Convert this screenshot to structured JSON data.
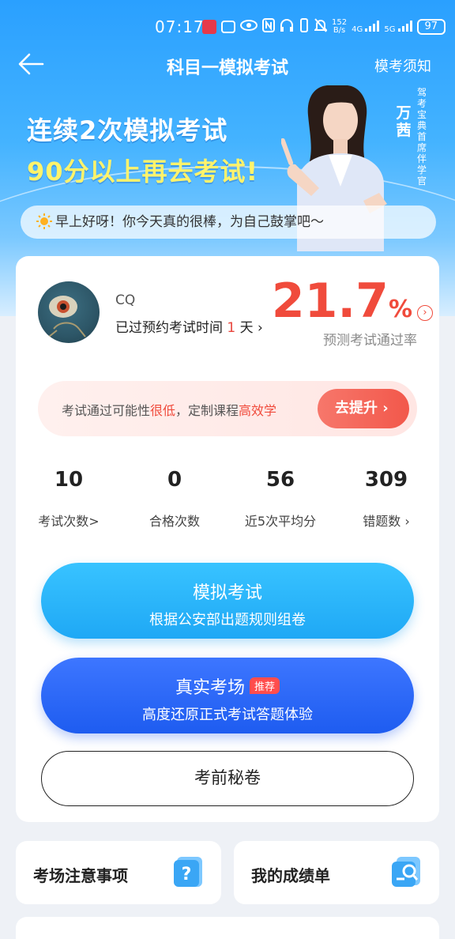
{
  "status_bar": {
    "time": "07:17",
    "net_speed_value": "152",
    "net_speed_unit": "B/s",
    "signal1": "4G",
    "signal2": "5G",
    "battery": "97"
  },
  "nav": {
    "title": "科目一模拟考试",
    "right_link": "模考须知"
  },
  "banner": {
    "slogan_line1": "连续2次模拟考试",
    "slogan_line2": "90分以上再去考试!",
    "coach_name": "万茜",
    "coach_title": "驾考宝典首席伴学官"
  },
  "greeting": "早上好呀！你今天真的很棒，为自己鼓掌吧～",
  "profile": {
    "username": "CQ",
    "exam_prefix": "已过预约考试时间",
    "exam_days": "1",
    "exam_suffix": "天",
    "exam_chevron": "›",
    "pass_rate_value": "21.7",
    "pass_rate_unit": "%",
    "pass_rate_label": "预测考试通过率"
  },
  "tip": {
    "part1": "考试通过可能性",
    "highlight1": "很低",
    "part2": "，定制课程",
    "highlight2": "高效学",
    "button": "去提升 ›"
  },
  "stats": [
    {
      "value": "10",
      "label": "考试次数>"
    },
    {
      "value": "0",
      "label": "合格次数"
    },
    {
      "value": "56",
      "label": "近5次平均分"
    },
    {
      "value": "309",
      "label": "错题数 ›"
    }
  ],
  "buttons": {
    "mock_title": "模拟考试",
    "mock_sub": "根据公安部出题规则组卷",
    "real_title": "真实考场",
    "real_badge": "推荐",
    "real_sub": "高度还原正式考试答题体验",
    "secret": "考前秘卷"
  },
  "bottom_cards": {
    "notes": "考场注意事项",
    "scores": "我的成绩单"
  },
  "colors": {
    "accent_red": "#f04b3c",
    "mock_blue": "#1fa8f5",
    "real_blue": "#1e5cf0"
  }
}
